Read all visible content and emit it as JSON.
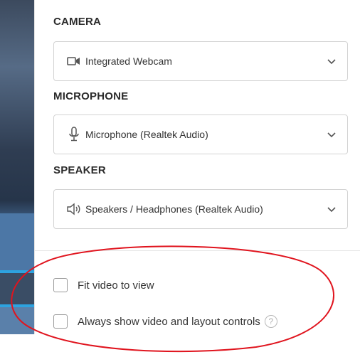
{
  "camera": {
    "label": "CAMERA",
    "selected": "Integrated Webcam",
    "icon": "video-camera-icon"
  },
  "microphone": {
    "label": "MICROPHONE",
    "selected": "Microphone (Realtek Audio)",
    "icon": "microphone-icon"
  },
  "speaker": {
    "label": "SPEAKER",
    "selected": "Speakers / Headphones (Realtek Audio)",
    "icon": "speaker-icon"
  },
  "options": {
    "fit_video": "Fit video to view",
    "always_show_controls": "Always show video and layout controls",
    "help_glyph": "?"
  },
  "colors": {
    "annotation": "#e0141e",
    "accent_strip": "#2da3e0"
  }
}
